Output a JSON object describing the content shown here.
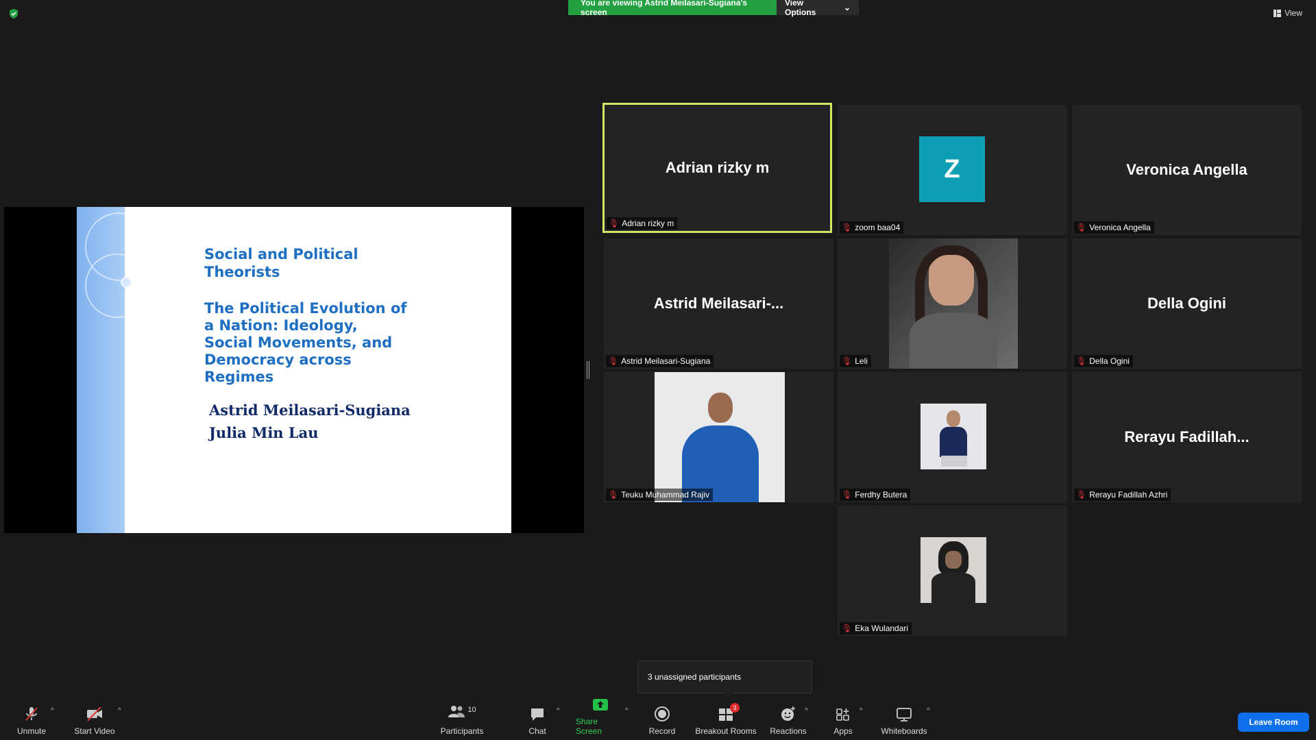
{
  "banner": {
    "message": "You are viewing Astrid Meilasari-Sugiana's screen",
    "options": "View Options"
  },
  "view_label": "View",
  "slide": {
    "title": "Social and Political Theorists",
    "subtitle": "The Political Evolution of a Nation: Ideology, Social Movements, and Democracy across Regimes",
    "author1": "Astrid Meilasari-Sugiana",
    "author2": "Julia Min Lau"
  },
  "tiles": [
    {
      "display": "Adrian rizky m",
      "name": "Adrian rizky m"
    },
    {
      "display": "Z",
      "name": "zoom baa04"
    },
    {
      "display": "Veronica Angella",
      "name": "Veronica Angella"
    },
    {
      "display": "Astrid  Meilasari-...",
      "name": "Astrid Meilasari-Sugiana"
    },
    {
      "display": "",
      "name": "Leli"
    },
    {
      "display": "Della Ogini",
      "name": "Della Ogini"
    },
    {
      "display": "",
      "name": "Teuku Muhammad Rajiv"
    },
    {
      "display": "",
      "name": "Ferdhy Butera"
    },
    {
      "display": "Rerayu  Fadillah...",
      "name": "Rerayu Fadillah Azhri"
    },
    {
      "display": "",
      "name": "Eka Wulandari"
    }
  ],
  "popup": "3 unassigned participants",
  "toolbar": {
    "unmute": "Unmute",
    "start_video": "Start Video",
    "participants": "Participants",
    "participants_count": "10",
    "chat": "Chat",
    "share_screen": "Share Screen",
    "record": "Record",
    "breakout_rooms": "Breakout Rooms",
    "breakout_badge": "3",
    "reactions": "Reactions",
    "apps": "Apps",
    "whiteboards": "Whiteboards",
    "leave": "Leave Room"
  },
  "colors": {
    "active_speaker": "#d3e764",
    "share_green": "#23a041",
    "leave_blue": "#0e71eb",
    "avatar_teal": "#0d9fb3"
  }
}
